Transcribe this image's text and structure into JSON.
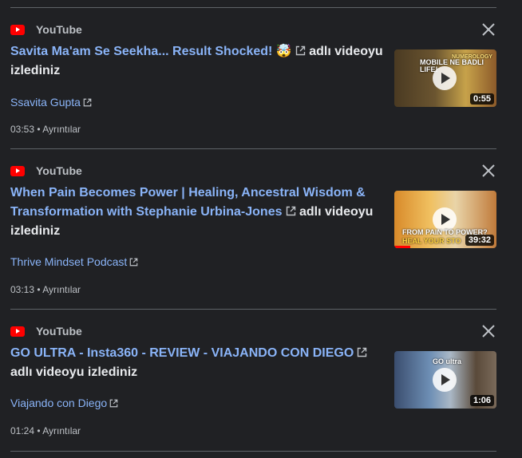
{
  "items": [
    {
      "source": "YouTube",
      "title_link": "Savita Ma'am Se Seekha... Result Shocked! 🤯",
      "title_suffix": "adlı videoyu izlediniz",
      "channel": "Ssavita Gupta",
      "time": "03:53",
      "details": "Ayrıntılar",
      "thumb_caption": "MOBILE NE BADLI LIFE!",
      "thumb_caption_small": "NUMEROLOGY",
      "duration": "0:55"
    },
    {
      "source": "YouTube",
      "title_link": "When Pain Becomes Power | Healing, Ancestral Wisdom & Transformation with Stephanie Urbina-Jones",
      "title_suffix": "adlı videoyu izlediniz",
      "channel": "Thrive Mindset Podcast",
      "time": "03:13",
      "details": "Ayrıntılar",
      "thumb_caption": "FROM PAIN TO POWER?",
      "thumb_caption2": "HEAL YOUR STO",
      "duration": "39:32",
      "watched_fraction": 0.16
    },
    {
      "source": "YouTube",
      "title_link": "GO ULTRA - Insta360 - REVIEW - VIAJANDO CON DIEGO",
      "title_suffix": "adlı videoyu izlediniz",
      "channel": "Viajando con Diego",
      "time": "01:24",
      "details": "Ayrıntılar",
      "thumb_caption": "GO ultra",
      "duration": "1:06"
    }
  ],
  "icons": {
    "source_logo": "youtube-logo-icon",
    "close": "close-icon",
    "external_link": "external-link-icon",
    "play": "play-icon"
  },
  "colors": {
    "background": "#202124",
    "link": "#8ab4f8",
    "text": "#e8eaed",
    "muted": "#bdc1c6",
    "brand": "#ff0000"
  }
}
